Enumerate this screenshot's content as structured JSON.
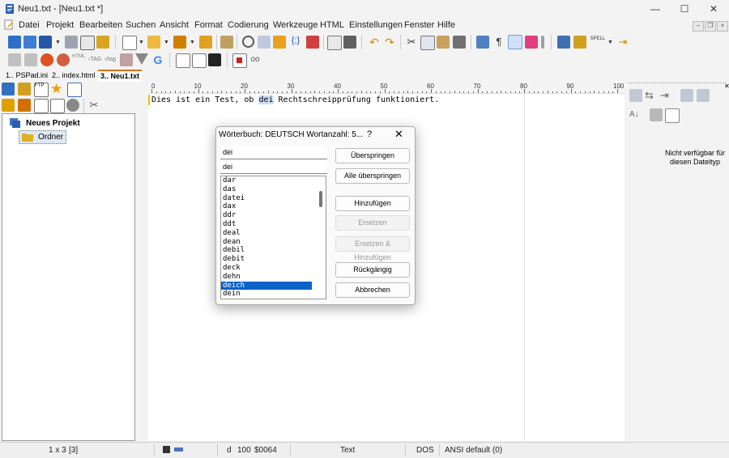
{
  "window": {
    "title": "Neu1.txt - [Neu1.txt *]",
    "minimize_glyph": "—",
    "maximize_glyph": "☐",
    "close_glyph": "✕"
  },
  "menu": [
    "Datei",
    "Projekt",
    "Bearbeiten",
    "Suchen",
    "Ansicht",
    "Format",
    "Codierung",
    "Werkzeuge",
    "HTML",
    "Einstellungen",
    "Fenster",
    "Hilfe"
  ],
  "mdi": {
    "minimize": "–",
    "restore": "❐",
    "close": "×"
  },
  "toolbar2": {
    "spell_label": "SPELL"
  },
  "tabs": [
    {
      "label": "1.. PSPad.ini",
      "active": false
    },
    {
      "label": "2.. index.html",
      "active": false
    },
    {
      "label": "3.. Neu1.txt",
      "active": true
    }
  ],
  "project_tree": {
    "root_label": "Neues Projekt",
    "child_label": "Ordner"
  },
  "editor": {
    "ruler_labels": [
      "0",
      "10",
      "20",
      "30",
      "40",
      "50",
      "60",
      "70",
      "80",
      "90",
      "100"
    ],
    "line_before": "Dies ist ein Test, ob ",
    "line_highlight": "dei",
    "line_after": " Rechtschreipprüfung funktioniert."
  },
  "right_panel": {
    "message": "Nicht verfügbar für diesen Dateityp"
  },
  "dialog": {
    "title": "Wörterbuch: DEUTSCH Wortanzahl: 5...",
    "help_glyph": "?",
    "close_glyph": "✕",
    "word_field": "dei",
    "replacement_field": "dei",
    "suggestions": [
      "dar",
      "das",
      "datei",
      "dax",
      "ddr",
      "ddt",
      "deal",
      "dean",
      "debil",
      "debit",
      "deck",
      "dehn",
      "deich",
      "dein"
    ],
    "selected_index": 12,
    "buttons": {
      "skip": "Überspringen",
      "skip_all": "Alle überspringen",
      "add": "Hinzufügen",
      "replace": "Ersetzen",
      "replace_add": "Ersetzen & Hinzufügen",
      "undo": "Rückgängig",
      "cancel": "Abbrechen"
    }
  },
  "status": {
    "position": "1 x 3",
    "selection": "[3]",
    "char": "d",
    "char_dec": "100",
    "char_hex": "$0064",
    "mode": "Text",
    "line_end": "DOS",
    "encoding": "ANSI default (0)"
  },
  "colors": {
    "accent": "#0a64c8",
    "tab_active_border": "#e07000",
    "word_highlight": "#cfe0f7"
  }
}
